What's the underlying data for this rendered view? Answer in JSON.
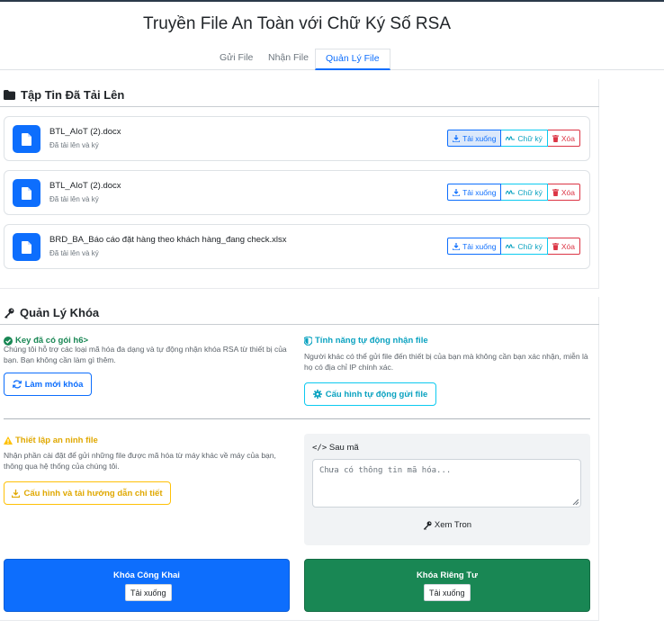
{
  "app": {
    "title": "Truyền File An Toàn với Chữ Ký Số RSA"
  },
  "tabs": [
    {
      "label": "Gửi File",
      "active": false
    },
    {
      "label": "Nhận File",
      "active": false
    },
    {
      "label": "Quản Lý File",
      "active": true
    }
  ],
  "uploaded": {
    "heading": "Tập Tin Đã Tải Lên",
    "files": [
      {
        "name": "BTL_AIoT (2).docx",
        "status": "Đã tải lên và ký"
      },
      {
        "name": "BTL_AIoT (2).docx",
        "status": "Đã tải lên và ký"
      },
      {
        "name": "BRD_BA_Báo cáo đặt hàng theo khách hàng_đang check.xlsx",
        "status": "Đã tải lên và ký"
      }
    ],
    "actions": {
      "download": "Tải xuống",
      "signature": "Chữ ký",
      "delete": "Xóa"
    }
  },
  "keys": {
    "heading": "Quản Lý Khóa",
    "has_key": {
      "title": "Key đã có gói h6>",
      "desc": "Chúng tôi hỗ trợ các loại mã hóa đa dạng và tự động nhận khóa RSA từ thiết bị của bạn. Bạn không cần làm gì thêm.",
      "button": "Làm mới khóa"
    },
    "auto_receive": {
      "title": "Tính năng tự động nhận file",
      "desc": "Người khác có thể gửi file đến thiết bị của bạn mà không cần bạn xác nhận, miễn là họ có địa chỉ IP chính xác.",
      "button": "Cấu hình tự động gửi file"
    },
    "security": {
      "title": "Thiết lập an ninh file",
      "desc": "Nhận phần cài đặt để gửi những file được mã hóa từ máy khác về máy của bạn, thông qua hệ thống của chúng tôi.",
      "button": "Cấu hình và tải hướng dẫn chi tiết"
    },
    "code": {
      "label": "Sau mã",
      "placeholder": "Chưa có thông tin mã hóa...",
      "view_raw": "Xem Tron"
    },
    "public_key": {
      "title": "Khóa Công Khai",
      "button": "Tải xuống"
    },
    "private_key": {
      "title": "Khóa Riêng Tư",
      "button": "Tải xuống"
    }
  },
  "colors": {
    "primary": "#0d6efd",
    "success": "#198754",
    "info": "#0dcaf0",
    "warning": "#ffc107",
    "danger": "#dc3545"
  },
  "icons": [
    "folder-icon",
    "file-icon",
    "download-icon",
    "signature-icon",
    "trash-icon",
    "key-icon",
    "check-circle-icon",
    "shield-icon",
    "sync-icon",
    "gear-icon",
    "warning-icon",
    "code-icon"
  ]
}
